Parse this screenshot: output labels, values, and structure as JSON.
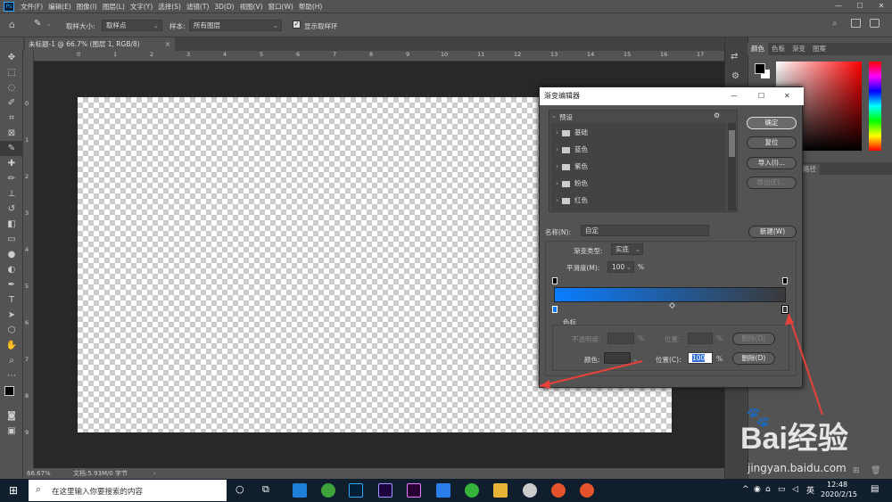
{
  "menu": {
    "logo": "Ps",
    "items": [
      "文件(F)",
      "编辑(E)",
      "图像(I)",
      "图层(L)",
      "文字(Y)",
      "选择(S)",
      "滤镜(T)",
      "3D(D)",
      "视图(V)",
      "窗口(W)",
      "帮助(H)"
    ]
  },
  "options": {
    "sample_size_label": "取样大小:",
    "sample_size_value": "取样点",
    "sample_label": "样本:",
    "sample_value": "所有图层",
    "show_ring_label": "显示取样环"
  },
  "document": {
    "tab_title": "未标题-1 @ 66.7% (图层 1, RGB/8)",
    "zoom": "66.67%",
    "doc_info": "文档:5.93M/0 字节"
  },
  "ruler": {
    "h_ticks": [
      "0",
      "1",
      "2",
      "3",
      "4",
      "5",
      "6",
      "7",
      "8",
      "9",
      "10",
      "11",
      "12",
      "13",
      "14",
      "15",
      "16",
      "17"
    ],
    "v_ticks": [
      "0",
      "1",
      "2",
      "3",
      "4",
      "5",
      "6",
      "7",
      "8",
      "9"
    ]
  },
  "right_panel": {
    "tabs": [
      "颜色",
      "色板",
      "渐变",
      "图案"
    ],
    "paths_label": "路径"
  },
  "dialog": {
    "title": "渐变编辑器",
    "presets_label": "预设",
    "presets": [
      "基础",
      "蓝色",
      "紫色",
      "粉色",
      "红色"
    ],
    "buttons": {
      "ok": "确定",
      "reset": "复位",
      "import": "导入(I)...",
      "export": "导出(E)...",
      "new": "新建(W)"
    },
    "name_label": "名称(N):",
    "name_value": "自定",
    "gradient_type_label": "渐变类型:",
    "gradient_type_value": "实底",
    "smoothness_label": "平滑度(M):",
    "smoothness_value": "100",
    "percent": "%",
    "gradient": {
      "start_color": "#0a7dff",
      "end_color": "#3a3a3a"
    },
    "stops_label": "色标",
    "opacity_label": "不透明度:",
    "location_label": "位置:",
    "delete_label": "删除(D)",
    "color_label": "颜色:",
    "location_c_label": "位置(C):",
    "location_c_value": "100"
  },
  "taskbar": {
    "search_placeholder": "在这里输入你要搜索的内容",
    "ime": "英",
    "time": "12:48",
    "date": "2020/2/15"
  },
  "watermark": {
    "brand": "Bai经验",
    "url": "jingyan.baidu.com"
  }
}
